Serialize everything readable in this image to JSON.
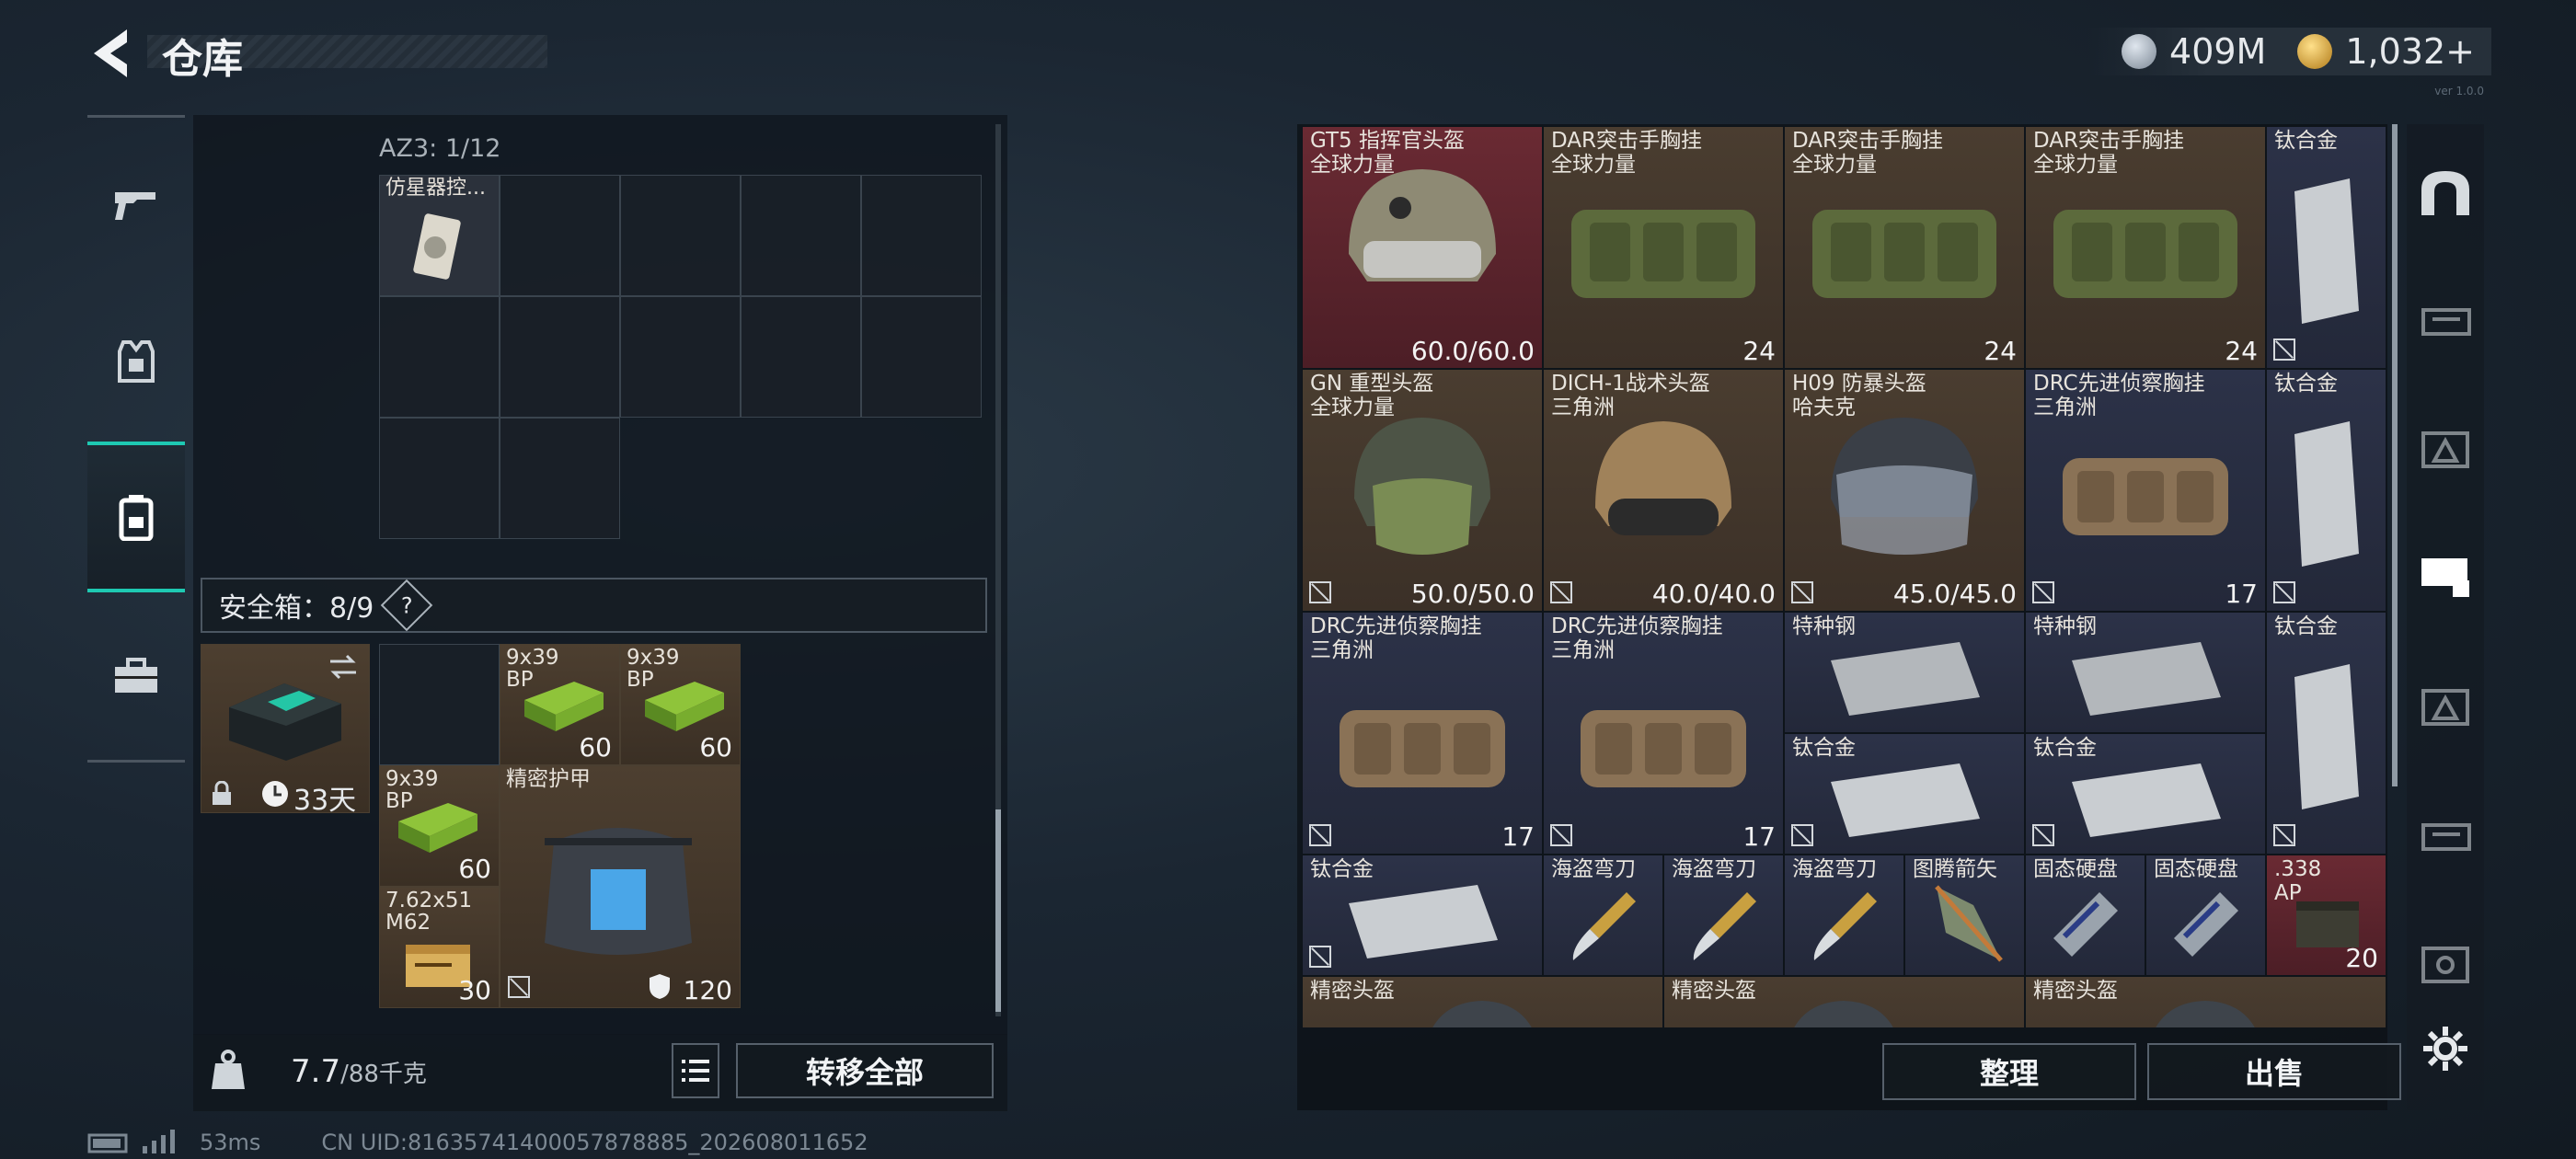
{
  "header": {
    "title": "仓库",
    "silver_amount": "409M",
    "gold_amount": "1,032+",
    "version": "ver 1.0.0"
  },
  "left_nav": [
    "weapons",
    "armor",
    "backpack",
    "case"
  ],
  "container": {
    "label": "AZ3: 1/12",
    "item": "仿星器控..."
  },
  "safe_box": {
    "label": "安全箱：8/9",
    "help": "?",
    "timer": "33天",
    "items": [
      {
        "name": "9x39\nBP",
        "qty": "60"
      },
      {
        "name": "9x39\nBP",
        "qty": "60"
      },
      {
        "name": "9x39\nBP",
        "qty": "60"
      },
      {
        "name": "精密护甲",
        "qty": "120"
      },
      {
        "name": "7.62x51\nM62",
        "qty": "30"
      }
    ]
  },
  "footer_left": {
    "weight": "7.7",
    "weight_unit": "/88千克",
    "transfer_all": "转移全部"
  },
  "warehouse": [
    {
      "name": "GT5 指挥官头盔\n全球力量",
      "value": "60.0/60.0"
    },
    {
      "name": "DAR突击手胸挂\n全球力量",
      "value": "24"
    },
    {
      "name": "DAR突击手胸挂\n全球力量",
      "value": "24"
    },
    {
      "name": "DAR突击手胸挂\n全球力量",
      "value": "24"
    },
    {
      "name": "钛合金",
      "value": ""
    },
    {
      "name": "GN 重型头盔\n全球力量",
      "value": "50.0/50.0"
    },
    {
      "name": "DICH-1战术头盔\n三角洲",
      "value": "40.0/40.0"
    },
    {
      "name": "H09 防暴头盔\n哈夫克",
      "value": "45.0/45.0"
    },
    {
      "name": "DRC先进侦察胸挂\n三角洲",
      "value": "17"
    },
    {
      "name": "钛合金",
      "value": ""
    },
    {
      "name": "DRC先进侦察胸挂\n三角洲",
      "value": "17"
    },
    {
      "name": "DRC先进侦察胸挂\n三角洲",
      "value": "17"
    },
    {
      "name": "特种钢",
      "value": ""
    },
    {
      "name": "特种钢",
      "value": ""
    },
    {
      "name": "钛合金",
      "value": ""
    },
    {
      "name": "钛合金",
      "value": ""
    },
    {
      "name": "钛合金",
      "value": ""
    },
    {
      "name": "钛合金",
      "value": ""
    },
    {
      "name": "海盗弯刀",
      "value": ""
    },
    {
      "name": "海盗弯刀",
      "value": ""
    },
    {
      "name": "海盗弯刀",
      "value": ""
    },
    {
      "name": "图腾箭矢",
      "value": ""
    },
    {
      "name": "固态硬盘",
      "value": ""
    },
    {
      "name": "固态硬盘",
      "value": ""
    },
    {
      "name": ".338\nAP",
      "value": "20"
    },
    {
      "name": "精密头盔",
      "value": ""
    },
    {
      "name": "精密头盔",
      "value": ""
    },
    {
      "name": "精密头盔",
      "value": ""
    }
  ],
  "footer_right": {
    "sort": "整理",
    "sell": "出售"
  },
  "status": {
    "ping": "53ms",
    "uid": "CN UID:81635741400057878885_202608011652"
  },
  "colors": {
    "accent": "#1ec9b2",
    "helmet_bg": "#6a2a33",
    "gear_bg": "#4a3d30",
    "material_bg": "#2c3248"
  }
}
